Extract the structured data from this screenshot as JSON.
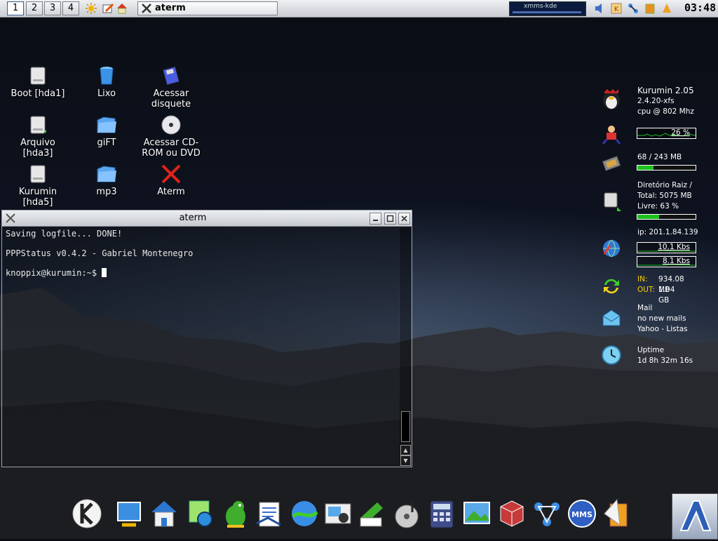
{
  "top_panel": {
    "desktops": [
      "1",
      "2",
      "3",
      "4"
    ],
    "active_desktop": "1",
    "task_title": "aterm",
    "xmms_label": "xmms-kde",
    "clock": "03:48"
  },
  "desktop_icons": [
    {
      "label": "Boot [hda1]",
      "icon": "hard-drive-icon"
    },
    {
      "label": "Lixo",
      "icon": "trash-icon"
    },
    {
      "label": "Acessar disquete",
      "icon": "floppy-icon"
    },
    {
      "label": "Arquivo [hda3]",
      "icon": "hard-drive-icon"
    },
    {
      "label": "giFT",
      "icon": "folder-icon"
    },
    {
      "label": "Acessar CD-ROM ou DVD",
      "icon": "cdrom-icon"
    },
    {
      "label": "Kurumin [hda5]",
      "icon": "hard-drive-icon"
    },
    {
      "label": "mp3",
      "icon": "folder-icon"
    },
    {
      "label": "Aterm",
      "icon": "x-icon"
    }
  ],
  "terminal": {
    "title": "aterm",
    "lines": [
      "Saving logfile... DONE!",
      "PPPStatus v0.4.2 - Gabriel Montenegro",
      "knoppix@kurumin:~$ "
    ]
  },
  "monitor": {
    "system": {
      "name": "Kurumin 2.05",
      "kernel": "2.4.20-xfs",
      "cpu": "cpu @ 802 Mhz"
    },
    "cpu_usage": {
      "label": "26 %",
      "percent": 26
    },
    "memory": {
      "label": "68 / 243 MB",
      "fraction": 0.28
    },
    "disk": {
      "title": "Diretório Raiz /",
      "total": "Total: 5075 MB",
      "free": "Livre: 63 %",
      "used_fraction": 0.37
    },
    "network": {
      "ip": "ip: 201.1.84.139",
      "down": "10.1 Kbs",
      "up": "8.1 Kbs"
    },
    "traffic": {
      "in_label": "IN:",
      "in_value": "934.08 MB",
      "out_label": "OUT:",
      "out_value": "1.04 GB"
    },
    "mail": {
      "title": "Mail",
      "status": "no new mails",
      "account": "Yahoo - Listas"
    },
    "uptime": {
      "title": "Uptime",
      "value": "1d 8h 32m 16s"
    }
  },
  "dock": [
    "kde-k-icon",
    "desktop-icon",
    "home-icon",
    "settings-icon",
    "mascot-icon",
    "text-editor-icon",
    "browser-icon",
    "photo-icon",
    "notes-icon",
    "music-icon",
    "calculator-icon",
    "image-viewer-icon",
    "kde-cube-icon",
    "network-icon",
    "xmms-icon",
    "package-icon"
  ],
  "colors": {
    "accent_green": "#1dc11d",
    "title_bar": "#c5c9cf",
    "terminal_text": "#e8e8e8",
    "in_out_label": "#ffd200"
  }
}
